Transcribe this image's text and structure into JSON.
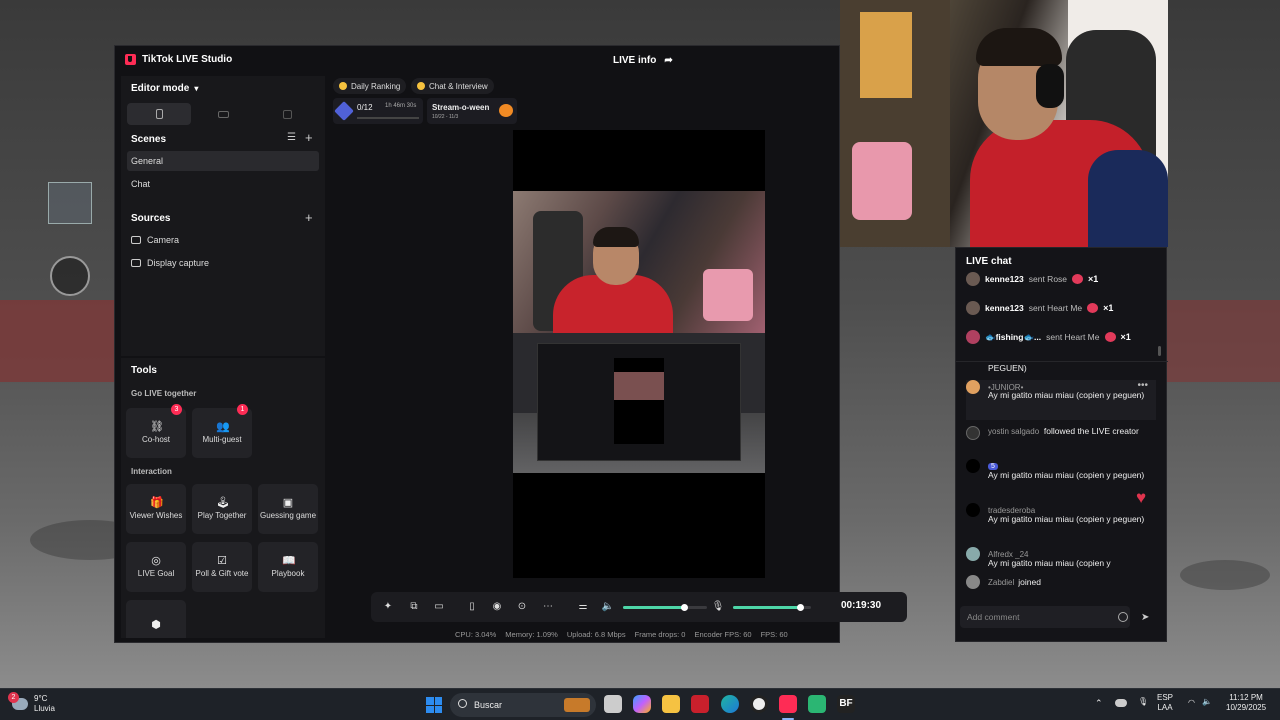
{
  "studio": {
    "app_title": "TikTok LIVE Studio",
    "live_info": "LIVE info",
    "editor_mode": "Editor mode",
    "scenes_label": "Scenes",
    "scenes": [
      {
        "label": "General",
        "active": true
      },
      {
        "label": "Chat",
        "active": false
      }
    ],
    "sources_label": "Sources",
    "sources": [
      {
        "label": "Camera",
        "icon": "camera-icon"
      },
      {
        "label": "Display capture",
        "icon": "monitor-icon"
      }
    ],
    "tools_label": "Tools",
    "go_live_together_label": "Go LIVE together",
    "cohost": {
      "label": "Co-host",
      "badge": "3"
    },
    "multiguest": {
      "label": "Multi-guest",
      "badge": "1"
    },
    "interaction_label": "Interaction",
    "tools": [
      {
        "label": "Viewer Wishes",
        "icon": "gift-icon"
      },
      {
        "label": "Play Together",
        "icon": "joystick-icon"
      },
      {
        "label": "Guessing game",
        "icon": "cards-icon"
      },
      {
        "label": "LIVE Goal",
        "icon": "target-icon"
      },
      {
        "label": "Poll & Gift vote",
        "icon": "poll-icon"
      },
      {
        "label": "Playbook",
        "icon": "book-icon"
      }
    ],
    "chips": {
      "daily_ranking": "Daily Ranking",
      "chat_interview": "Chat & Interview"
    },
    "ranking": {
      "value": "0/12",
      "time": "1h 46m 30s",
      "progress": 0
    },
    "event": {
      "title": "Stream-o-ween",
      "dates": "10/22 - 11/3"
    },
    "timer": "00:19:30",
    "mic_level": 0.73,
    "speaker_level": 0.86,
    "stats": {
      "cpu": "CPU: 3.04%",
      "memory": "Memory: 1.09%",
      "upload": "Upload: 6.8 Mbps",
      "frame_drops": "Frame drops: 0",
      "encoder_fps": "Encoder FPS: 60",
      "fps": "FPS: 60"
    }
  },
  "chat": {
    "title": "LIVE chat",
    "gifts": [
      {
        "user": "kenne123",
        "action": "sent Rose",
        "count": "×1"
      },
      {
        "user": "kenne123",
        "action": "sent Heart Me",
        "count": "×1"
      },
      {
        "user": "🐟fishing🐟...",
        "action": "sent Heart Me",
        "count": "×1"
      }
    ],
    "messages": [
      {
        "name": "",
        "text": "PEGUEN)"
      },
      {
        "name": "•JUNIOR•",
        "text": "Ay mi gatito miau miau (copien y peguen)"
      },
      {
        "name": "yostin salgado",
        "text": "followed the LIVE creator"
      },
      {
        "name": "5",
        "text": "Ay mi gatito miau miau (copien y peguen)"
      },
      {
        "name": "tradesderoba",
        "text": "Ay mi gatito miau miau (copien y peguen)"
      },
      {
        "name": "Alfredx _24",
        "text": "Ay mi gatito miau miau (copien y"
      },
      {
        "name": "Zabdiel",
        "text": "joined"
      }
    ],
    "comment_placeholder": "Add comment"
  },
  "taskbar": {
    "weather_temp": "9°C",
    "weather_desc": "Lluvia",
    "weather_badge": "2",
    "search_label": "Buscar",
    "lang": "ESP",
    "lang_sub": "LAA",
    "time": "11:12 PM",
    "date": "10/29/2025"
  }
}
